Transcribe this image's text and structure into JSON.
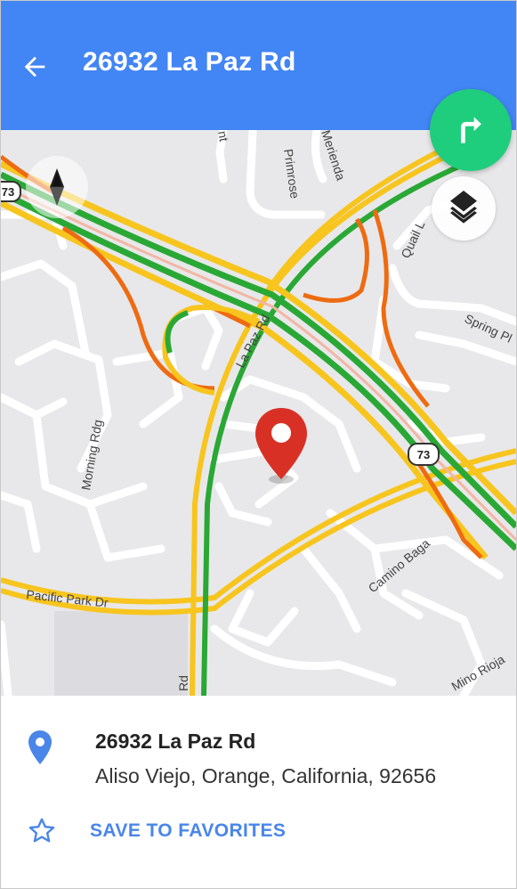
{
  "header": {
    "title": "26932 La Paz Rd",
    "back_icon": "arrow-left-icon"
  },
  "map": {
    "street_labels": {
      "primrose": "Primrose",
      "merienda": "Merienda",
      "quail": "Quail L",
      "spring": "Spring Pl",
      "la_paz": "La Paz Rd",
      "morning": "Morning Rdg",
      "camino_baga": "Camino Baga",
      "pacific_park": "Pacific Park Dr",
      "rioja": "Mino Rioja",
      "partial_top": "nt",
      "partial_bottom": "Rd"
    },
    "route_shield_top_left": "73",
    "route_shield_center": "73",
    "icons": {
      "compass": "compass-icon",
      "layers": "layers-icon",
      "directions": "turn-right-icon",
      "pin": "map-pin-icon"
    },
    "colors": {
      "traffic_fast": "#2aa835",
      "traffic_medium": "#f7c51e",
      "traffic_slow": "#ee6b11",
      "pin": "#d93025"
    }
  },
  "place": {
    "name": "26932 La Paz Rd",
    "address": "Aliso Viejo, Orange, California, 92656",
    "pin_icon": "location-pin-icon"
  },
  "actions": {
    "save_favorites": "SAVE TO FAVORITES",
    "star_icon": "star-outline-icon"
  },
  "colors": {
    "appbar": "#4285f4",
    "accent": "#4a86e8",
    "fab": "#1fce7c"
  }
}
